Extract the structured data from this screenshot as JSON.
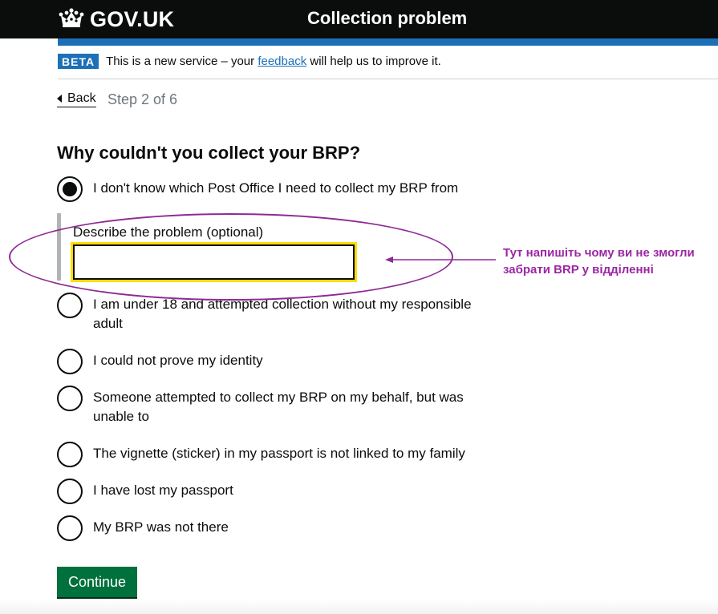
{
  "header": {
    "logo_text": "GOV.UK",
    "service_name": "Collection problem"
  },
  "phase_banner": {
    "tag": "BETA",
    "text_before": "This is a new service – your ",
    "link": "feedback",
    "text_after": " will help us to improve it."
  },
  "nav": {
    "back_label": "Back",
    "step": "Step 2 of 6"
  },
  "form": {
    "question": "Why couldn't you collect your BRP?",
    "options": [
      {
        "label": "I don't know which Post Office I need to collect my BRP from",
        "selected": true
      },
      {
        "label": "I am under 18 and attempted collection without my responsible adult",
        "selected": false
      },
      {
        "label": "I could not prove my identity",
        "selected": false
      },
      {
        "label": "Someone attempted to collect my BRP on my behalf, but was unable to",
        "selected": false
      },
      {
        "label": "The vignette (sticker) in my passport is not linked to my family",
        "selected": false
      },
      {
        "label": "I have lost my passport",
        "selected": false
      },
      {
        "label": "My BRP was not there",
        "selected": false
      }
    ],
    "conditional_label": "Describe the problem (optional)",
    "conditional_value": "",
    "continue_label": "Continue"
  },
  "annotation": {
    "text": "Тут напишіть чому ви не змогли забрати BRP у відділенні"
  },
  "colors": {
    "header_bg": "#0b0c0c",
    "brand_blue": "#1d70b8",
    "button_green": "#00703c",
    "focus_yellow": "#ffdd00",
    "annotation_purple": "#9b27a3"
  },
  "icons": {
    "logo": "crown-icon",
    "back": "back-arrow-icon",
    "annotation": "arrow-left-icon"
  }
}
